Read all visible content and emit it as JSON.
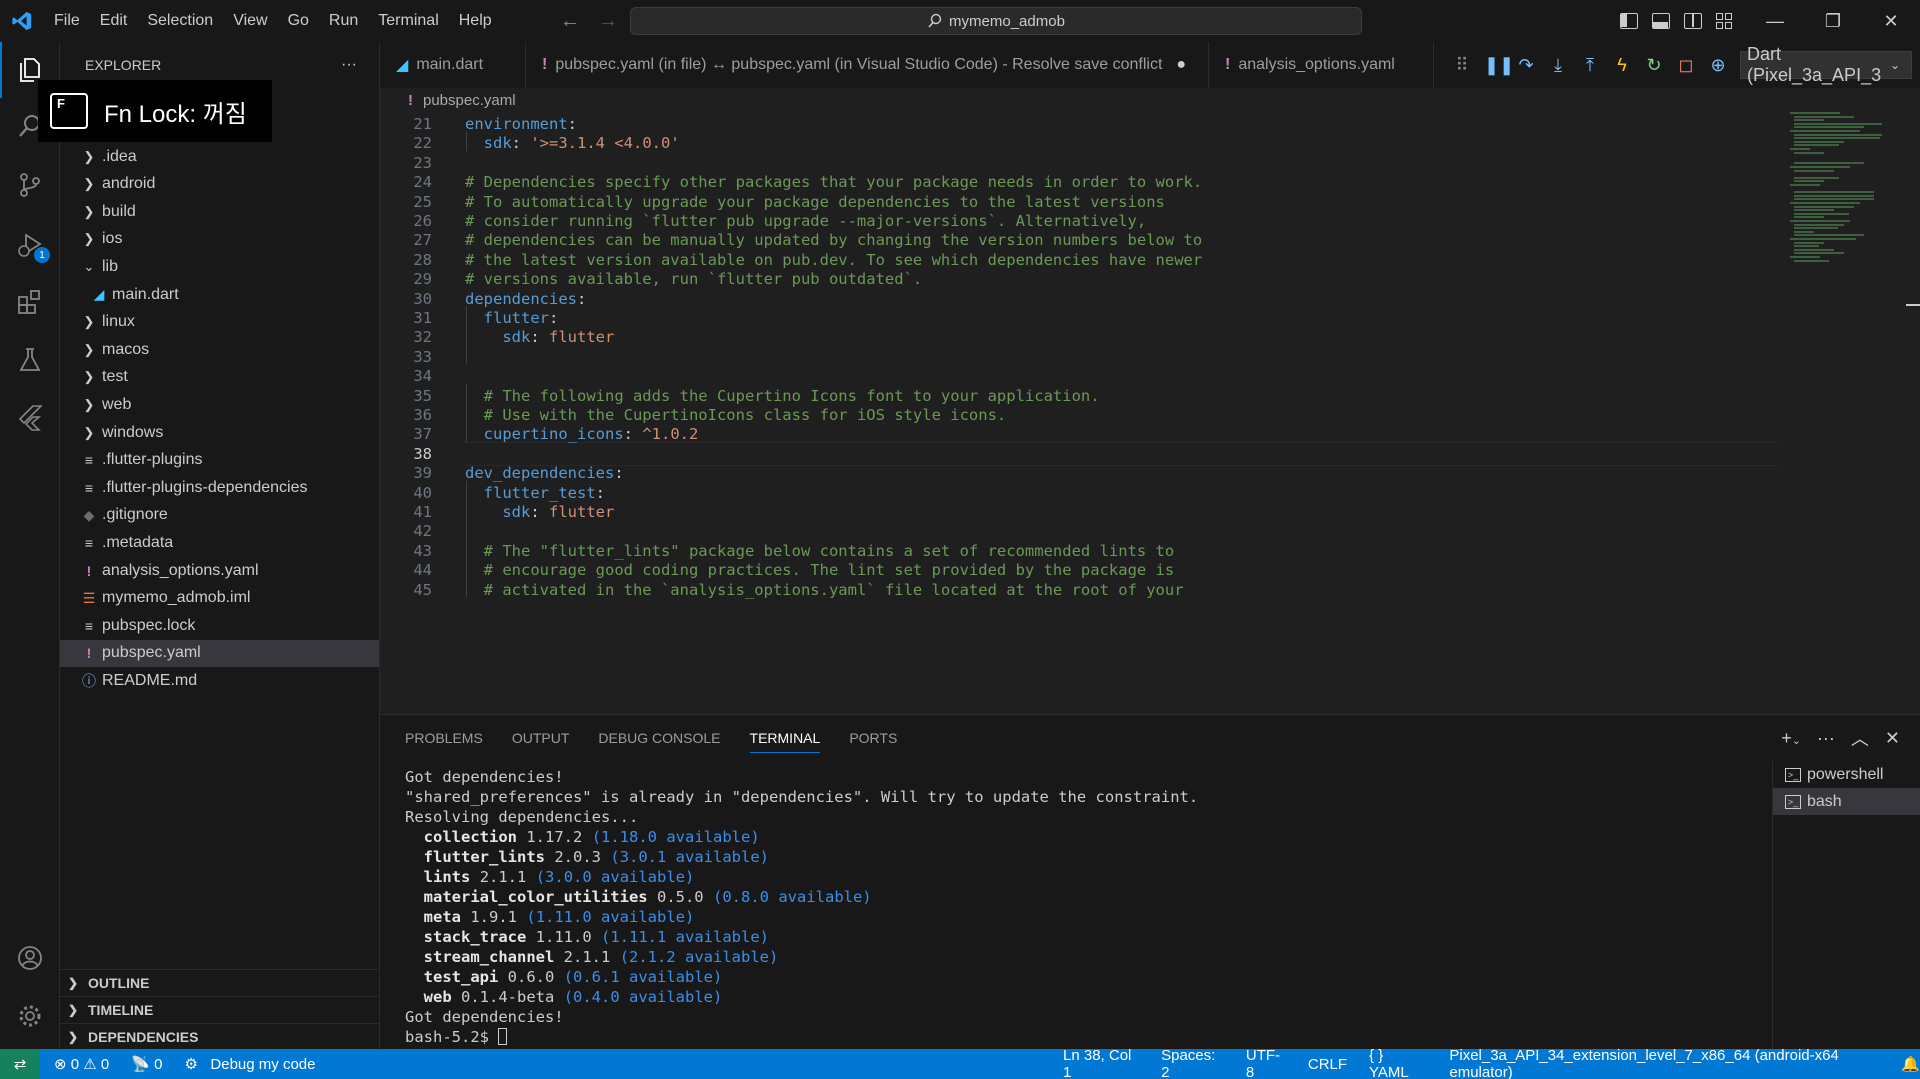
{
  "titlebar": {
    "menu": [
      "File",
      "Edit",
      "Selection",
      "View",
      "Go",
      "Run",
      "Terminal",
      "Help"
    ],
    "search": "mymemo_admob"
  },
  "overlay": {
    "fn_lock": "Fn Lock: 꺼짐",
    "key": "F"
  },
  "activity": {
    "debug_badge": "1"
  },
  "sidebar": {
    "title": "EXPLORER",
    "more": "···",
    "items": [
      {
        "label": ".idea",
        "kind": "folder"
      },
      {
        "label": "android",
        "kind": "folder"
      },
      {
        "label": "build",
        "kind": "folder"
      },
      {
        "label": "ios",
        "kind": "folder"
      },
      {
        "label": "lib",
        "kind": "folder-open"
      },
      {
        "label": "main.dart",
        "kind": "dart"
      },
      {
        "label": "linux",
        "kind": "folder"
      },
      {
        "label": "macos",
        "kind": "folder"
      },
      {
        "label": "test",
        "kind": "folder"
      },
      {
        "label": "web",
        "kind": "folder"
      },
      {
        "label": "windows",
        "kind": "folder"
      },
      {
        "label": ".flutter-plugins",
        "kind": "file"
      },
      {
        "label": ".flutter-plugins-dependencies",
        "kind": "file"
      },
      {
        "label": ".gitignore",
        "kind": "git"
      },
      {
        "label": ".metadata",
        "kind": "file"
      },
      {
        "label": "analysis_options.yaml",
        "kind": "yaml"
      },
      {
        "label": "mymemo_admob.iml",
        "kind": "rss"
      },
      {
        "label": "pubspec.lock",
        "kind": "file"
      },
      {
        "label": "pubspec.yaml",
        "kind": "yaml"
      },
      {
        "label": "README.md",
        "kind": "info"
      }
    ],
    "sections": [
      "OUTLINE",
      "TIMELINE",
      "DEPENDENCIES"
    ]
  },
  "editor": {
    "tabs": [
      {
        "label": "main.dart",
        "icon": "dart"
      },
      {
        "label": "pubspec.yaml (in file) ↔ pubspec.yaml (in Visual Studio Code) - Resolve save conflict",
        "icon": "!",
        "dirty": "●"
      },
      {
        "label": "analysis_options.yaml",
        "icon": "!"
      }
    ],
    "debug_target": "Dart (Pixel_3a_API_3",
    "breadcrumb": "pubspec.yaml",
    "line_numbers": [
      "21",
      "22",
      "23",
      "24",
      "25",
      "26",
      "27",
      "28",
      "29",
      "30",
      "31",
      "32",
      "33",
      "34",
      "35",
      "36",
      "37",
      "38",
      "39",
      "40",
      "41",
      "42",
      "43",
      "44",
      "45"
    ],
    "lines": [
      "environment:",
      "  sdk: '>=3.1.4 <4.0.0'",
      "",
      "# Dependencies specify other packages that your package needs in order to work.",
      "# To automatically upgrade your package dependencies to the latest versions",
      "# consider running `flutter pub upgrade --major-versions`. Alternatively,",
      "# dependencies can be manually updated by changing the version numbers below to",
      "# the latest version available on pub.dev. To see which dependencies have newer",
      "# versions available, run `flutter pub outdated`.",
      "dependencies:",
      "  flutter:",
      "    sdk: flutter",
      "",
      "",
      "  # The following adds the Cupertino Icons font to your application.",
      "  # Use with the CupertinoIcons class for iOS style icons.",
      "  cupertino_icons: ^1.0.2",
      "",
      "dev_dependencies:",
      "  flutter_test:",
      "    sdk: flutter",
      "",
      "  # The \"flutter_lints\" package below contains a set of recommended lints to",
      "  # encourage good coding practices. The lint set provided by the package is",
      "  # activated in the `analysis_options.yaml` file located at the root of your"
    ]
  },
  "panel": {
    "tabs": [
      "PROBLEMS",
      "OUTPUT",
      "DEBUG CONSOLE",
      "TERMINAL",
      "PORTS"
    ],
    "active_tab": "TERMINAL",
    "terminal": {
      "line1": "Got dependencies!",
      "line2": "\"shared_preferences\" is already in \"dependencies\". Will try to update the constraint.",
      "line3": "Resolving dependencies...",
      "packages": [
        {
          "name": "collection",
          "version": "1.17.2",
          "available": "(1.18.0 available)"
        },
        {
          "name": "flutter_lints",
          "version": "2.0.3",
          "available": "(3.0.1 available)"
        },
        {
          "name": "lints",
          "version": "2.1.1",
          "available": "(3.0.0 available)"
        },
        {
          "name": "material_color_utilities",
          "version": "0.5.0",
          "available": "(0.8.0 available)"
        },
        {
          "name": "meta",
          "version": "1.9.1",
          "available": "(1.11.0 available)"
        },
        {
          "name": "stack_trace",
          "version": "1.11.0",
          "available": "(1.11.1 available)"
        },
        {
          "name": "stream_channel",
          "version": "2.1.1",
          "available": "(2.1.2 available)"
        },
        {
          "name": "test_api",
          "version": "0.6.0",
          "available": "(0.6.1 available)"
        },
        {
          "name": "web",
          "version": "0.1.4-beta",
          "available": "(0.4.0 available)"
        }
      ],
      "line_end": "Got dependencies!",
      "prompt": "bash-5.2$ "
    },
    "terminals": [
      "powershell",
      "bash"
    ]
  },
  "statusbar": {
    "errors": "0",
    "warnings": "0",
    "ports": "0",
    "debug": "Debug my code",
    "position": "Ln 38, Col 1",
    "spaces": "Spaces: 2",
    "encoding": "UTF-8",
    "eol": "CRLF",
    "language": "YAML",
    "device": "Pixel_3a_API_34_extension_level_7_x86_64 (android-x64 emulator)"
  },
  "colors": {
    "accent": "#0078d4",
    "statusbar": "#0078d4",
    "keyword": "#569cd6",
    "string": "#ce9178",
    "comment": "#6a9955"
  }
}
